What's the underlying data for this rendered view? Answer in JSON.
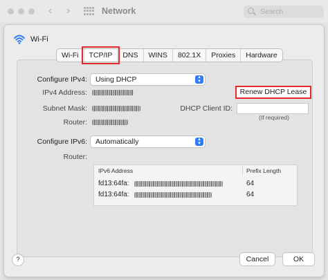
{
  "window": {
    "title": "Network",
    "search_placeholder": "Search"
  },
  "service": {
    "name": "Wi-Fi"
  },
  "tabs": [
    {
      "label": "Wi-Fi"
    },
    {
      "label": "TCP/IP"
    },
    {
      "label": "DNS"
    },
    {
      "label": "WINS"
    },
    {
      "label": "802.1X"
    },
    {
      "label": "Proxies"
    },
    {
      "label": "Hardware"
    }
  ],
  "active_tab": "TCP/IP",
  "tcpip": {
    "configure_ipv4_label": "Configure IPv4:",
    "configure_ipv4_value": "Using DHCP",
    "ipv4_address_label": "IPv4 Address:",
    "subnet_mask_label": "Subnet Mask:",
    "router_label": "Router:",
    "renew_button": "Renew DHCP Lease",
    "dhcp_client_id_label": "DHCP Client ID:",
    "dhcp_client_id_value": "",
    "if_required": "(If required)",
    "configure_ipv6_label": "Configure IPv6:",
    "configure_ipv6_value": "Automatically",
    "router6_label": "Router:",
    "ipv6_table": {
      "headers": [
        "IPv6 Address",
        "Prefix Length"
      ],
      "rows": [
        {
          "address": "fd13:64fa:",
          "prefix": "64"
        },
        {
          "address": "fd13:64fa:",
          "prefix": "64"
        }
      ]
    }
  },
  "footer": {
    "help_label": "?",
    "cancel_label": "Cancel",
    "ok_label": "OK"
  },
  "colors": {
    "highlight": "#e0282d",
    "accent": "#2f7cf6"
  }
}
